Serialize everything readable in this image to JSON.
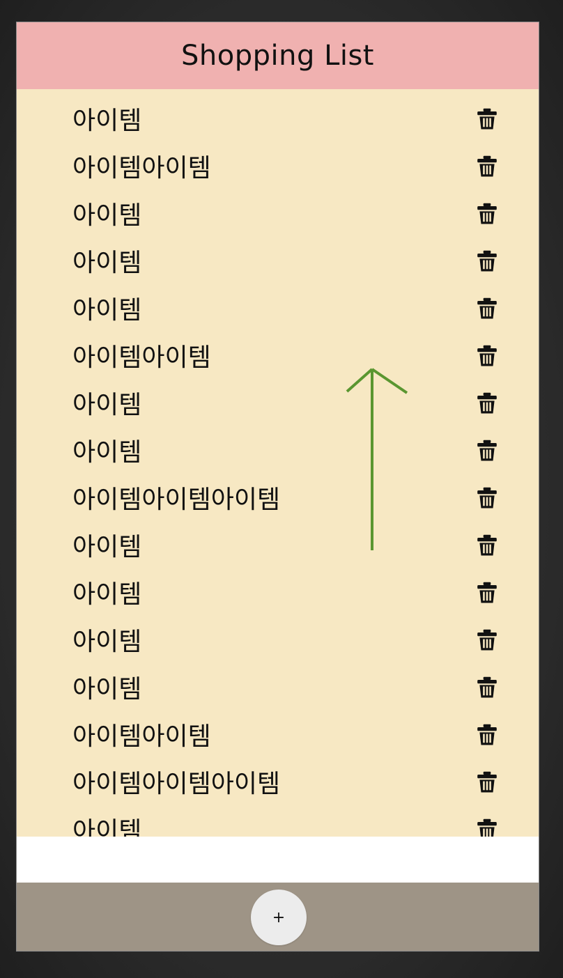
{
  "header": {
    "title": "Shopping List"
  },
  "items": [
    {
      "label": "아이템"
    },
    {
      "label": "아이템아이템"
    },
    {
      "label": "아이템"
    },
    {
      "label": "아이템"
    },
    {
      "label": "아이템"
    },
    {
      "label": "아이템아이템"
    },
    {
      "label": "아이템"
    },
    {
      "label": "아이템"
    },
    {
      "label": "아이템아이템아이템"
    },
    {
      "label": "아이템"
    },
    {
      "label": "아이템"
    },
    {
      "label": "아이템"
    },
    {
      "label": "아이템"
    },
    {
      "label": "아이템아이템"
    },
    {
      "label": "아이템아이템아이템"
    },
    {
      "label": "아이템"
    }
  ],
  "item_icon": "trash-icon",
  "footer": {
    "add_label": "+"
  },
  "overlay": {
    "icon": "arrow-up-icon",
    "color": "#5a9630"
  },
  "colors": {
    "header_bg": "#f0b1b0",
    "list_bg": "#f7e8c3",
    "footer_bg": "#9e9486",
    "add_button_bg": "#ececec"
  }
}
